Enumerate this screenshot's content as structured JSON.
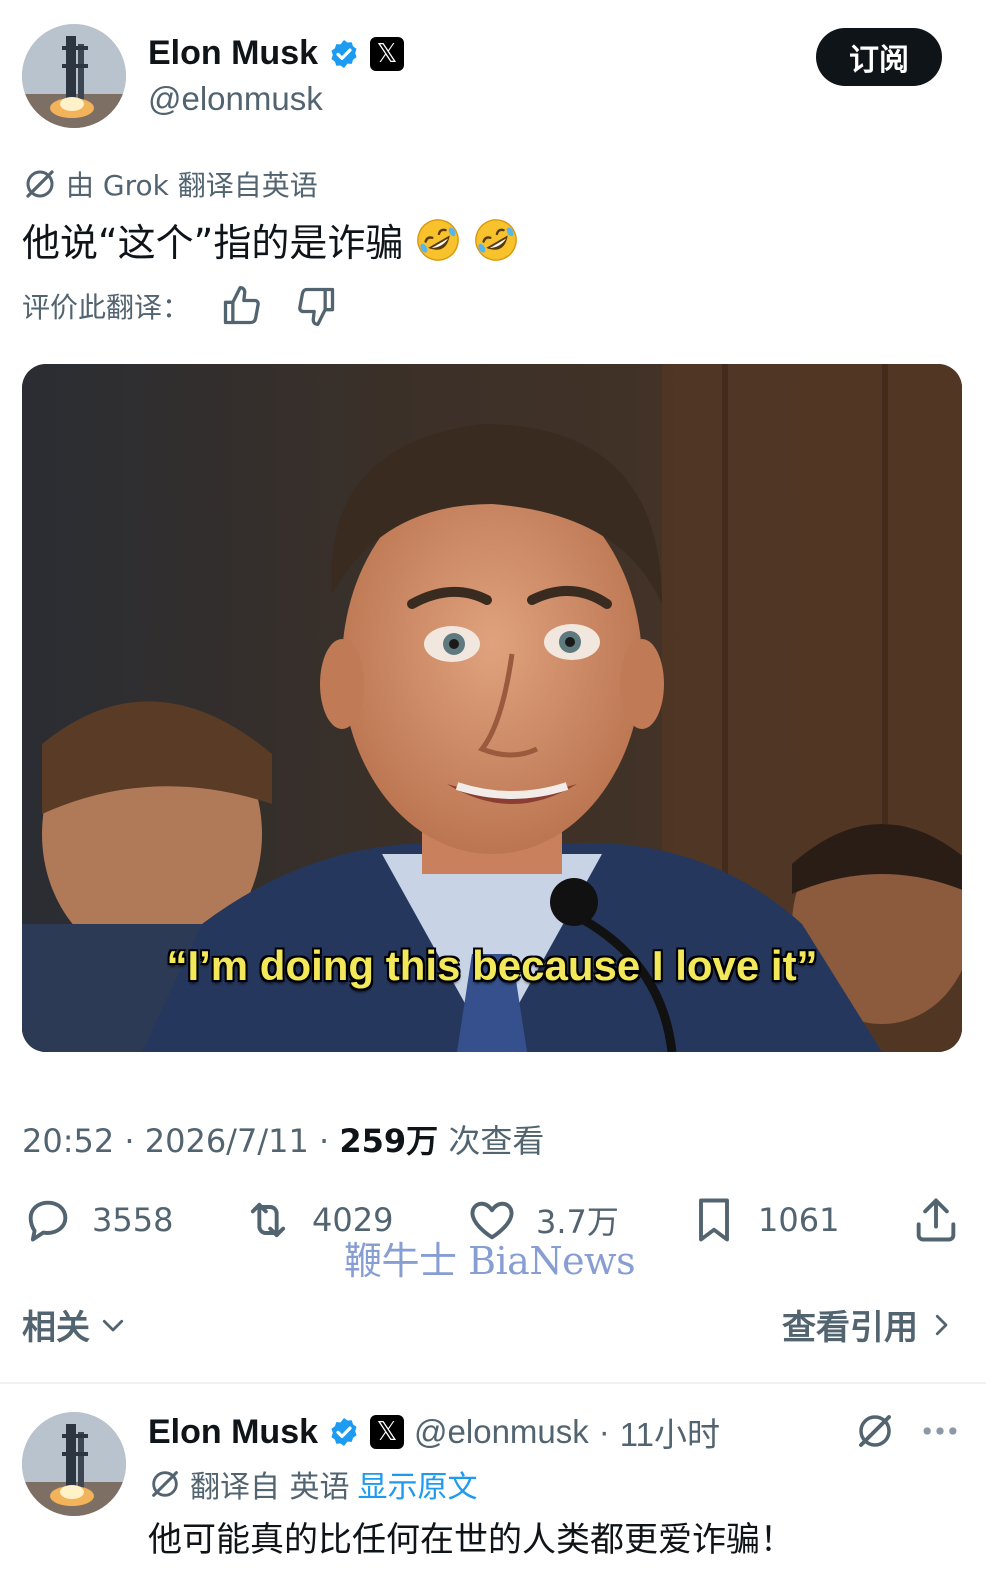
{
  "colors": {
    "text": "#0f1419",
    "secondary": "#536471",
    "verified": "#1d9bf0",
    "link": "#1d9bf0",
    "subscribe_bg": "#0f1419",
    "caption": "#f2e85a",
    "watermark": "#6a86c9"
  },
  "post": {
    "author_name": "Elon Musk",
    "author_handle": "@elonmusk",
    "subscribe_label": "订阅",
    "translation_note": "由 Grok 翻译自英语",
    "text": "他说“这个”指的是诈骗",
    "emojis": [
      "rolling-on-floor-laughing",
      "rolling-on-floor-laughing"
    ],
    "rate_label": "评价此翻译：",
    "media_caption": "“I’m doing this because I love it”",
    "time": "20:52",
    "date": "2026/7/11",
    "views_count": "259万",
    "views_label": "次查看",
    "stats": {
      "replies": "3558",
      "reposts": "4029",
      "likes": "3.7万",
      "bookmarks": "1061"
    }
  },
  "watermark": "鞭牛士 BiaNews",
  "related": {
    "label": "相关",
    "quotes_label": "查看引用"
  },
  "reply": {
    "author_name": "Elon Musk",
    "author_handle": "@elonmusk",
    "age": "11小时",
    "translation_note": "翻译自 英语",
    "show_original": "显示原文",
    "text": "他可能真的比任何在世的人类都更爱诈骗！"
  },
  "icons": {
    "verified": "verified-badge-icon",
    "x_logo": "x-logo-icon",
    "translate": "translate-icon",
    "thumbs_up": "thumbs-up-icon",
    "thumbs_down": "thumbs-down-icon",
    "reply": "reply-icon",
    "repost": "repost-icon",
    "like": "heart-icon",
    "bookmark": "bookmark-icon",
    "share": "share-icon",
    "chevron_down": "chevron-down-icon",
    "chevron_right": "chevron-right-icon",
    "more": "more-icon"
  }
}
